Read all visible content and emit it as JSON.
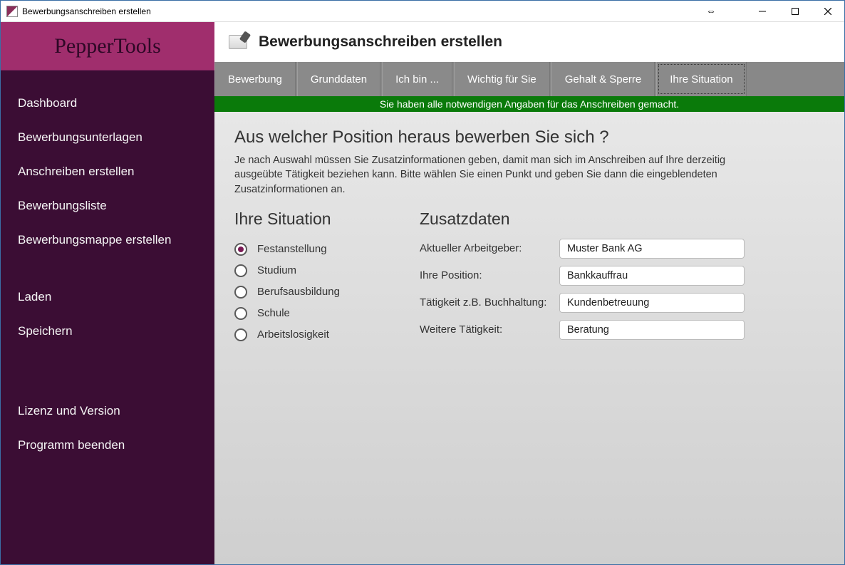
{
  "window": {
    "title": "Bewerbungsanschreiben erstellen"
  },
  "brand": "PepperTools",
  "sidebar": {
    "group1": [
      {
        "label": "Dashboard"
      },
      {
        "label": "Bewerbungsunterlagen"
      },
      {
        "label": "Anschreiben erstellen"
      },
      {
        "label": "Bewerbungsliste"
      },
      {
        "label": "Bewerbungsmappe erstellen"
      }
    ],
    "group2": [
      {
        "label": "Laden"
      },
      {
        "label": "Speichern"
      }
    ],
    "group3": [
      {
        "label": "Lizenz und Version"
      },
      {
        "label": "Programm beenden"
      }
    ]
  },
  "header": {
    "title": "Bewerbungsanschreiben erstellen"
  },
  "tabs": [
    {
      "label": "Bewerbung"
    },
    {
      "label": "Grunddaten"
    },
    {
      "label": "Ich bin ..."
    },
    {
      "label": "Wichtig für Sie"
    },
    {
      "label": "Gehalt & Sperre"
    },
    {
      "label": "Ihre Situation",
      "active": true
    }
  ],
  "status": "Sie haben alle notwendigen Angaben für das Anschreiben gemacht.",
  "panel": {
    "heading": "Aus welcher Position heraus bewerben Sie sich ?",
    "description": "Je nach Auswahl müssen Sie Zusatzinformationen geben, damit man sich im Anschreiben auf Ihre derzeitig ausgeübte Tätigkeit beziehen kann. Bitte wählen Sie einen Punkt und geben Sie dann die eingeblendeten Zusatzinformationen an.",
    "situation_title": "Ihre Situation",
    "extras_title": "Zusatzdaten",
    "radios": [
      {
        "label": "Festanstellung",
        "checked": true
      },
      {
        "label": "Studium",
        "checked": false
      },
      {
        "label": "Berufsausbildung",
        "checked": false
      },
      {
        "label": "Schule",
        "checked": false
      },
      {
        "label": "Arbeitslosigkeit",
        "checked": false
      }
    ],
    "fields": [
      {
        "label": "Aktueller Arbeitgeber:",
        "value": "Muster Bank AG"
      },
      {
        "label": "Ihre Position:",
        "value": "Bankkauffrau"
      },
      {
        "label": "Tätigkeit z.B. Buchhaltung:",
        "value": "Kundenbetreuung"
      },
      {
        "label": "Weitere Tätigkeit:",
        "value": "Beratung"
      }
    ]
  }
}
